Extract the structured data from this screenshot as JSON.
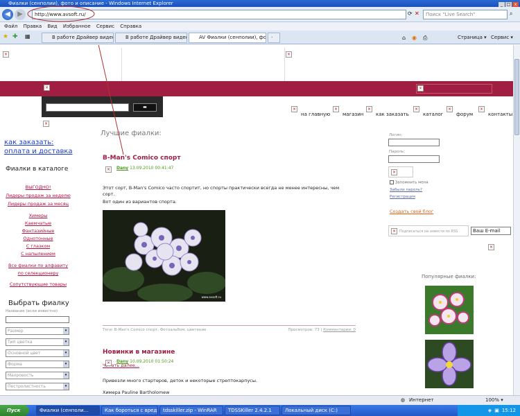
{
  "window": {
    "title": "Фиалки (сенполии), фото и описание - Windows Internet Explorer"
  },
  "address": {
    "url": "http://www.avsoft.ru/",
    "search_placeholder": "Поиск \"Live Search\""
  },
  "menu": [
    "Файл",
    "Правка",
    "Вид",
    "Избранное",
    "Сервис",
    "Справка"
  ],
  "tabs": [
    "В работе Драйвер видеока...",
    "В работе Драйвер видеока...",
    "AV Фиалки (сенполии), фот..."
  ],
  "toolbar_right": {
    "page": "Страница",
    "tools": "Сервис"
  },
  "site": {
    "nav": [
      "на главную",
      "магазин",
      "как заказать",
      "каталог",
      "форум",
      "контакты"
    ],
    "order_link1": "как заказать:",
    "order_link2": "оплата и доставка",
    "catalog_heading": "Фиалки в каталоге",
    "catalog_links_1": [
      "ВЫГОДНО!",
      "Лидеры продаж за неделю",
      "Лидеры продаж за месяц"
    ],
    "catalog_links_2": [
      "Химеры",
      "Каемчатые",
      "Фантазийные",
      "Однотонные",
      "С глазком",
      "С напылением"
    ],
    "catalog_links_3": [
      "Все фиалки по алфавиту",
      "по селекционеру"
    ],
    "catalog_links_4": [
      "Сопутствующие товары"
    ],
    "choose_heading": "Выбрать фиалку",
    "name_label": "Название (если известно)",
    "selects": [
      "Размер",
      "Тип цветка",
      "Основной цвет",
      "Форма",
      "Махровость",
      "Пестролистность"
    ],
    "section_title": "Лучшие фиалки:",
    "post1": {
      "title": "B-Man's Comico спорт",
      "author": "Dany",
      "date": "13.09.2010 00:41:47",
      "body1": "Этот сорт, B-Man's Comico часто спортит, но спорты практически всегда не менее интересны, чем сорт.",
      "body2": "Вот один из вариантов спорта.",
      "read_more": "Читать далее...",
      "footer_left": "Теги: B-Man's Comico спорт, Фотоальбом, цветение",
      "footer_right": "Просмотров: 73 |",
      "comments": "Комментарии: 0"
    },
    "post2": {
      "title": "Новинки в магазине",
      "author": "Dany",
      "date": "10.09.2010 01:50:24",
      "body1": "Привезли много стартеров, деток и некоторые стрептокарпусы.",
      "body2": "Химера Pauline Bartholomew"
    },
    "login": {
      "login_label": "Логин:",
      "password_label": "Пароль:",
      "remember": "Запомнить меня",
      "forgot": "Забыли пароль?",
      "register": "Регистрация",
      "create_blog": "Создать свой блог"
    },
    "rss": {
      "text": "Подписаться на новости по RSS",
      "email": "Ваш E-mail"
    },
    "popular": "Популярные фиалки:",
    "photo_caption": "www.avsoft.ru"
  },
  "status": {
    "zone": "Интернет",
    "zoom": "100%"
  },
  "taskbar": {
    "start": "Пуск",
    "tasks": [
      "Фиалки (сенполи...",
      "Как бороться с вред...",
      "tdsskiller.zip - WinRAR",
      "TDSSKiller 2.4.2.1",
      "Локальный диск (C:)"
    ],
    "time": "15:12"
  },
  "colors": {
    "brand_maroon": "#a01e42",
    "link_red": "#b0103e",
    "title_blue": "#1a3ec9",
    "author_green": "#4a9a1a"
  }
}
